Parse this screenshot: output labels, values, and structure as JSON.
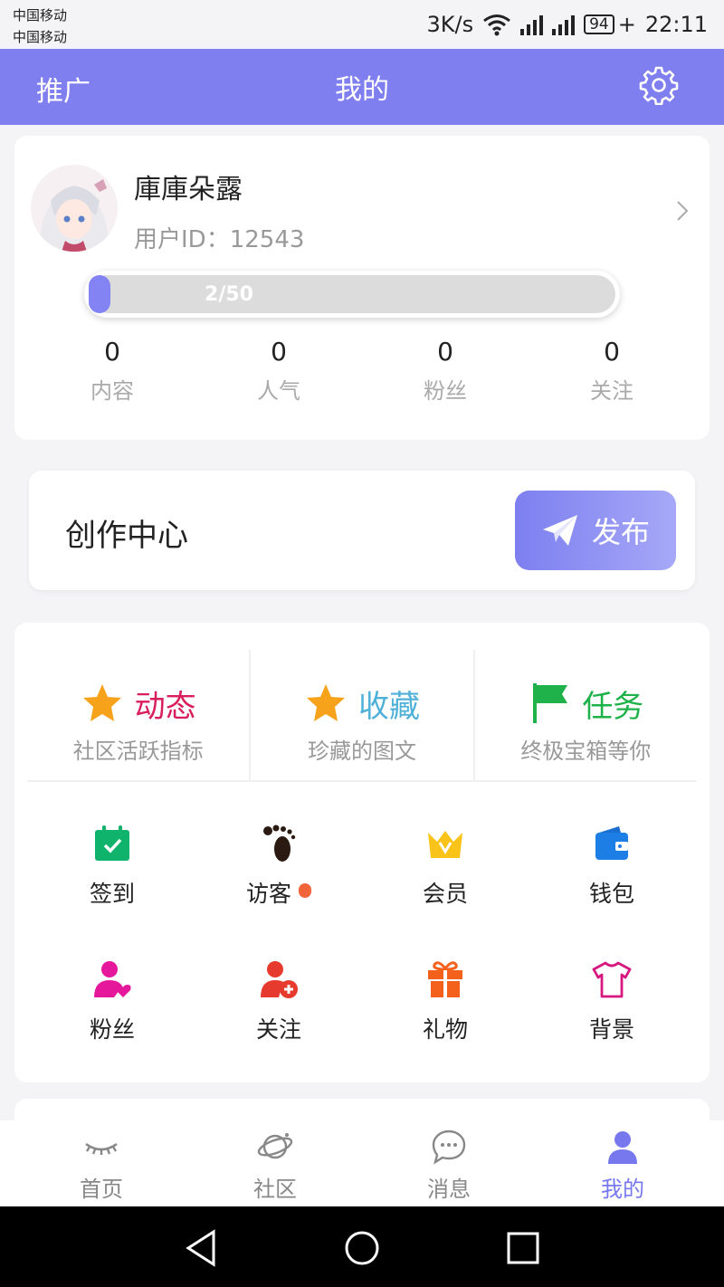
{
  "status_bar": {
    "carrier1": "中国移动",
    "carrier2": "中国移动",
    "speed": "3K/s",
    "battery": "94",
    "time": "22:11"
  },
  "header": {
    "left_label": "推广",
    "title": "我的",
    "settings_icon": "gear-icon"
  },
  "profile": {
    "username": "庫庫朵露",
    "user_id": "用户ID：12543",
    "progress_text": "2/50",
    "progress_fraction": 0.04,
    "stats": [
      {
        "value": "0",
        "label": "内容"
      },
      {
        "value": "0",
        "label": "人气"
      },
      {
        "value": "0",
        "label": "粉丝"
      },
      {
        "value": "0",
        "label": "关注"
      }
    ]
  },
  "create": {
    "title": "创作中心",
    "publish_label": "发布"
  },
  "features": [
    {
      "title": "动态",
      "subtitle": "社区活跃指标",
      "color": "#d81e5b",
      "icon": "star-icon"
    },
    {
      "title": "收藏",
      "subtitle": "珍藏的图文",
      "color": "#4fb0d8",
      "icon": "star-icon"
    },
    {
      "title": "任务",
      "subtitle": "终极宝箱等你",
      "color": "#1fb24a",
      "icon": "flag-icon"
    }
  ],
  "grid_items": [
    {
      "label": "签到",
      "icon": "calendar-check-icon"
    },
    {
      "label": "访客",
      "icon": "footprint-icon"
    },
    {
      "label": "会员",
      "icon": "crown-icon"
    },
    {
      "label": "钱包",
      "icon": "wallet-icon"
    },
    {
      "label": "粉丝",
      "icon": "user-heart-icon"
    },
    {
      "label": "关注",
      "icon": "user-add-icon"
    },
    {
      "label": "礼物",
      "icon": "gift-icon"
    },
    {
      "label": "背景",
      "icon": "tshirt-icon"
    }
  ],
  "bottom_nav": [
    {
      "label": "首页",
      "icon": "eye-closed-icon"
    },
    {
      "label": "社区",
      "icon": "planet-icon"
    },
    {
      "label": "消息",
      "icon": "chat-icon"
    },
    {
      "label": "我的",
      "icon": "user-icon",
      "active": true
    }
  ],
  "colors": {
    "accent": "#7f7ff0",
    "active_nav": "#7878ee"
  }
}
